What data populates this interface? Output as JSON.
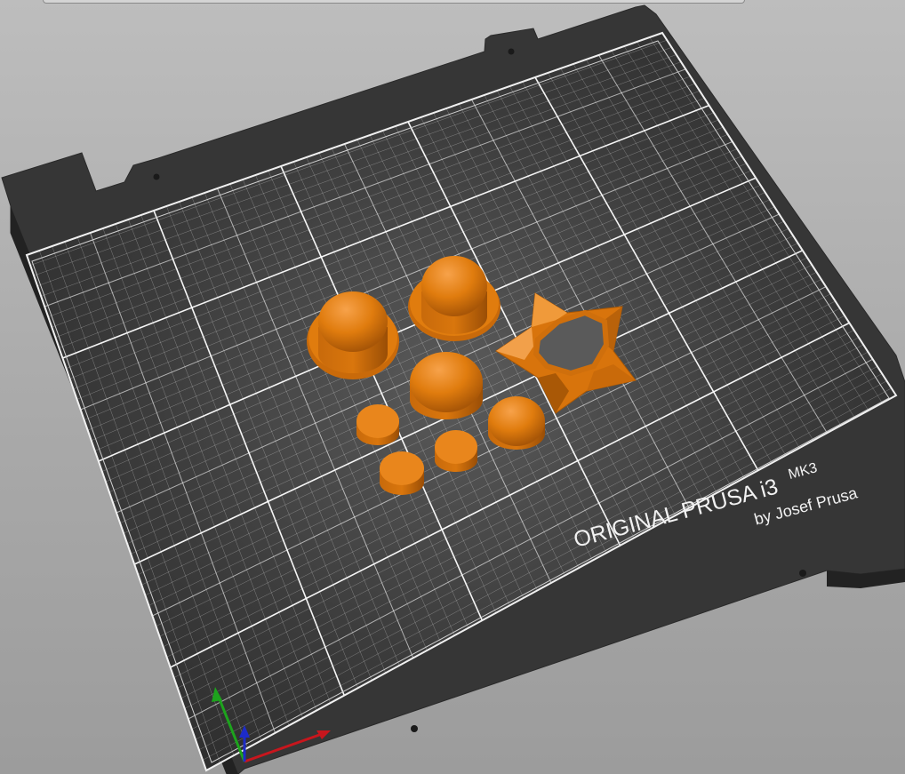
{
  "scene": {
    "bed_model": "prusa-mk3-heatbed",
    "background_color": "#b0b0b0",
    "bed_color": "#3a3a3a",
    "grid_color": "#ffffff",
    "object_color": "#e07c0e",
    "axis_colors": {
      "x": "#c8161d",
      "y": "#1da31d",
      "z": "#1d2bc8"
    }
  },
  "bed_texture": {
    "brand": "ORIGINAL PRUSA i3",
    "model": "MK3",
    "author": "by Josef Prusa"
  },
  "objects": [
    {
      "name": "hat-large-left",
      "type": "dome-with-brim"
    },
    {
      "name": "hat-large-right",
      "type": "dome-with-brim"
    },
    {
      "name": "dome-center",
      "type": "dome"
    },
    {
      "name": "dome-small-right",
      "type": "dome"
    },
    {
      "name": "disc-1",
      "type": "cylinder"
    },
    {
      "name": "disc-2",
      "type": "cylinder"
    },
    {
      "name": "disc-3",
      "type": "cylinder"
    },
    {
      "name": "star-ring",
      "type": "star-prism"
    }
  ]
}
